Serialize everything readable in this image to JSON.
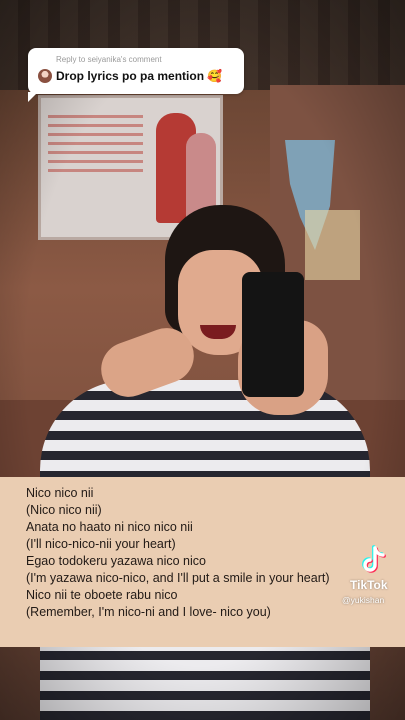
{
  "reply_comment": {
    "reply_to": "Reply to seiyanika's comment",
    "text": "Drop lyrics po pa mention 🥰"
  },
  "lyrics": [
    "Nico nico nii",
    "(Nico nico nii)",
    "Anata no haato ni nico nico nii",
    "(I'll nico-nico-nii your heart)",
    "Egao todokeru yazawa nico nico",
    "(I'm yazawa nico-nico,  and I'll put a smile in your heart)",
    "Nico nii te oboete rabu nico",
    "(Remember,  I'm nico-ni and I love- nico you)"
  ],
  "watermark": {
    "brand": "TikTok",
    "username": "@yukishan",
    "icon": "tiktok-logo-icon"
  },
  "colors": {
    "lyrics_panel": "#eacdb2",
    "bubble": "#ffffff",
    "tiktok_cyan": "#25f4ee",
    "tiktok_red": "#fe2c55"
  }
}
